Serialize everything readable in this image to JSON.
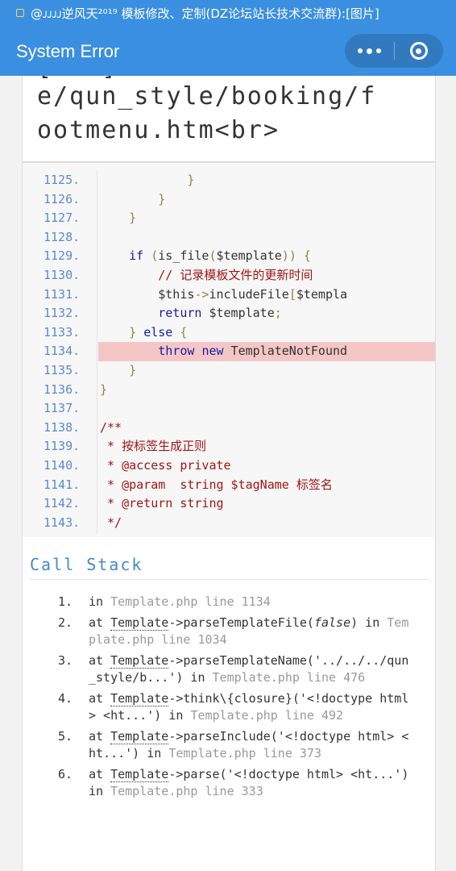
{
  "status_bar": {
    "title": "@ᴊᴊᴊᴊ逆风天²⁰¹⁹ 模板修改、定制(DZ论坛站长技术交流群):[图片]"
  },
  "title_bar": {
    "title": "System Error",
    "more_icon": "more-dots-icon",
    "close_icon": "target-close-icon"
  },
  "error_message": {
    "partial_line": "[...]",
    "line1": "e/qun_style/booking/f",
    "line2": "ootmenu.htm<br>"
  },
  "source": {
    "lines": [
      {
        "n": "1125.",
        "code": "            }"
      },
      {
        "n": "1126.",
        "code": "        }"
      },
      {
        "n": "1127.",
        "code": "    }"
      },
      {
        "n": "1128.",
        "code": ""
      },
      {
        "n": "1129.",
        "code": "    if (is_file($template)) {"
      },
      {
        "n": "1130.",
        "code": "        // 记录模板文件的更新时间"
      },
      {
        "n": "1131.",
        "code": "        $this->includeFile[$templa"
      },
      {
        "n": "1132.",
        "code": "        return $template;"
      },
      {
        "n": "1133.",
        "code": "    } else {"
      },
      {
        "n": "1134.",
        "code": "        throw new TemplateNotFound"
      },
      {
        "n": "1135.",
        "code": "    }"
      },
      {
        "n": "1136.",
        "code": "}"
      },
      {
        "n": "1137.",
        "code": ""
      },
      {
        "n": "1138.",
        "code": "/**"
      },
      {
        "n": "1139.",
        "code": " * 按标签生成正则"
      },
      {
        "n": "1140.",
        "code": " * @access private"
      },
      {
        "n": "1141.",
        "code": " * @param  string $tagName 标签名"
      },
      {
        "n": "1142.",
        "code": " * @return string"
      },
      {
        "n": "1143.",
        "code": " */"
      }
    ],
    "highlight_line": "1134."
  },
  "call_stack": {
    "heading": "Call Stack",
    "items": [
      {
        "num": "1.",
        "parts": [
          [
            "t",
            "in "
          ],
          [
            "g",
            "Template.php line 1134"
          ]
        ]
      },
      {
        "num": "2.",
        "parts": [
          [
            "t",
            "at "
          ],
          [
            "a",
            "Template"
          ],
          [
            "t",
            "->parseTemplateFile("
          ],
          [
            "e",
            "false"
          ],
          [
            "t",
            ") in "
          ],
          [
            "g",
            "Template.php line 1034"
          ]
        ]
      },
      {
        "num": "3.",
        "parts": [
          [
            "t",
            "at "
          ],
          [
            "a",
            "Template"
          ],
          [
            "t",
            "->parseTemplateName('../../../qun_style/b...') in "
          ],
          [
            "g",
            "Template.php line 476"
          ]
        ]
      },
      {
        "num": "4.",
        "parts": [
          [
            "t",
            "at "
          ],
          [
            "a",
            "Template"
          ],
          [
            "t",
            "->think\\{closure}('<!doctype html> <ht...') in "
          ],
          [
            "g",
            "Template.php line 492"
          ]
        ]
      },
      {
        "num": "5.",
        "parts": [
          [
            "t",
            "at "
          ],
          [
            "a",
            "Template"
          ],
          [
            "t",
            "->parseInclude('<!doctype html> <ht...') in "
          ],
          [
            "g",
            "Template.php line 373"
          ]
        ]
      },
      {
        "num": "6.",
        "parts": [
          [
            "t",
            "at "
          ],
          [
            "a",
            "Template"
          ],
          [
            "t",
            "->parse('<!doctype html> <ht...') in "
          ],
          [
            "g",
            "Template.php line 333"
          ]
        ]
      }
    ]
  },
  "colors": {
    "brand": "#3b8fe0",
    "highlight": "#f5c6c6",
    "line_number": "#5a8bd0",
    "heading": "#4488cc"
  }
}
